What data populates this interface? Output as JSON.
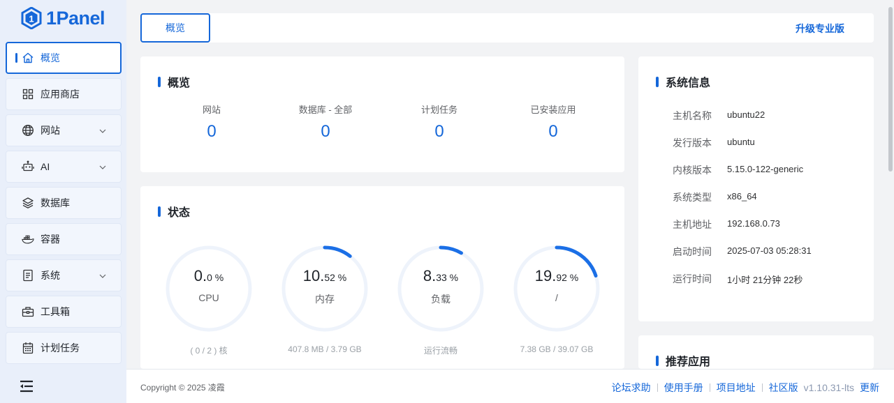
{
  "brand": {
    "name": "1Panel",
    "color": "#1567d9"
  },
  "sidebar": {
    "items": [
      {
        "label": "概览",
        "icon": "home-icon",
        "active": true,
        "expandable": false
      },
      {
        "label": "应用商店",
        "icon": "grid-icon",
        "active": false,
        "expandable": false
      },
      {
        "label": "网站",
        "icon": "globe-icon",
        "active": false,
        "expandable": true
      },
      {
        "label": "AI",
        "icon": "robot-icon",
        "active": false,
        "expandable": true
      },
      {
        "label": "数据库",
        "icon": "layers-icon",
        "active": false,
        "expandable": false
      },
      {
        "label": "容器",
        "icon": "docker-icon",
        "active": false,
        "expandable": false
      },
      {
        "label": "系统",
        "icon": "document-icon",
        "active": false,
        "expandable": true
      },
      {
        "label": "工具箱",
        "icon": "toolbox-icon",
        "active": false,
        "expandable": false
      },
      {
        "label": "计划任务",
        "icon": "calendar-icon",
        "active": false,
        "expandable": false
      }
    ]
  },
  "topbar": {
    "tab_label": "概览",
    "upgrade_label": "升级专业版"
  },
  "overview": {
    "title": "概览",
    "items": [
      {
        "label": "网站",
        "value": "0"
      },
      {
        "label": "数据库 - 全部",
        "value": "0"
      },
      {
        "label": "计划任务",
        "value": "0"
      },
      {
        "label": "已安装应用",
        "value": "0"
      }
    ]
  },
  "status": {
    "title": "状态",
    "gauges": [
      {
        "int": "0.",
        "dec": "0 %",
        "percent": 0.0,
        "name": "CPU",
        "footer": "( 0 / 2 ) 核"
      },
      {
        "int": "10.",
        "dec": "52 %",
        "percent": 10.52,
        "name": "内存",
        "footer": "407.8 MB / 3.79 GB"
      },
      {
        "int": "8.",
        "dec": "33 %",
        "percent": 8.33,
        "name": "负载",
        "footer": "运行流畅"
      },
      {
        "int": "19.",
        "dec": "92 %",
        "percent": 19.92,
        "name": "/",
        "footer": "7.38 GB / 39.07 GB"
      }
    ]
  },
  "system_info": {
    "title": "系统信息",
    "rows": [
      {
        "key": "主机名称",
        "value": "ubuntu22"
      },
      {
        "key": "发行版本",
        "value": "ubuntu"
      },
      {
        "key": "内核版本",
        "value": "5.15.0-122-generic"
      },
      {
        "key": "系统类型",
        "value": "x86_64"
      },
      {
        "key": "主机地址",
        "value": "192.168.0.73"
      },
      {
        "key": "启动时间",
        "value": "2025-07-03 05:28:31"
      },
      {
        "key": "运行时间",
        "value": "1小时 21分钟 22秒"
      }
    ]
  },
  "recommend": {
    "title": "推荐应用"
  },
  "footer": {
    "copyright": "Copyright © 2025 凌霞",
    "links": [
      "论坛求助",
      "使用手册",
      "项目地址",
      "社区版"
    ],
    "version": "v1.10.31-lts",
    "update_label": "更新"
  }
}
